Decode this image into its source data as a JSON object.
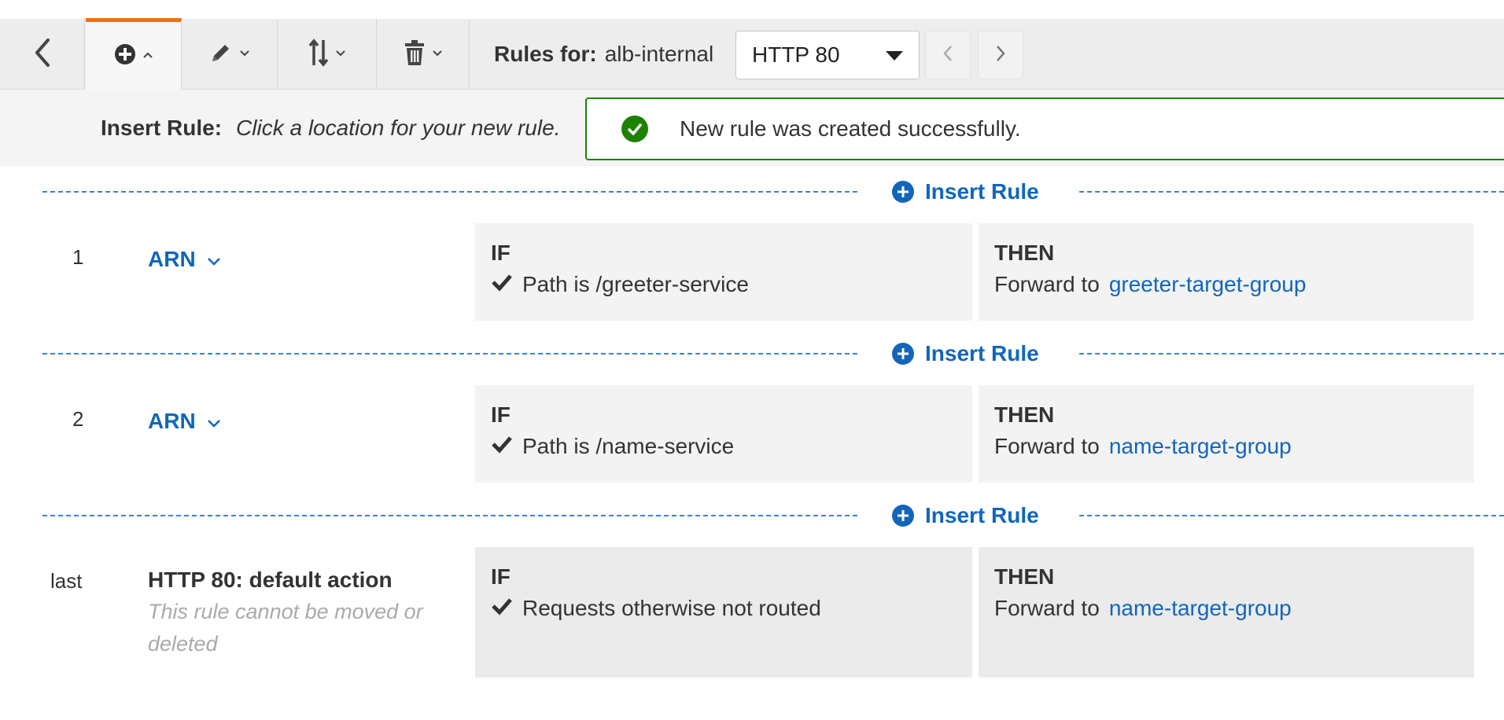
{
  "toolbar": {
    "rules_for_label": "Rules for:",
    "load_balancer": "alb-internal",
    "listener_selected": "HTTP 80"
  },
  "insert_hint": {
    "label": "Insert Rule:",
    "text": "Click a location for your new rule."
  },
  "flash": {
    "message": "New rule was created successfully."
  },
  "insert_label": "Insert Rule",
  "rules": [
    {
      "number": "1",
      "name": "ARN",
      "if_label": "IF",
      "condition": "Path is /greeter-service",
      "then_label": "THEN",
      "action": "Forward to",
      "target": "greeter-target-group"
    },
    {
      "number": "2",
      "name": "ARN",
      "if_label": "IF",
      "condition": "Path is /name-service",
      "then_label": "THEN",
      "action": "Forward to",
      "target": "name-target-group"
    }
  ],
  "default_rule": {
    "number": "last",
    "title": "HTTP 80: default action",
    "note": "This rule cannot be moved or deleted",
    "if_label": "IF",
    "condition": "Requests otherwise not routed",
    "then_label": "THEN",
    "action": "Forward to",
    "target": "name-target-group"
  },
  "colors": {
    "accent_tab": "#ec7211",
    "link": "#1166bb",
    "success": "#1d8102"
  }
}
